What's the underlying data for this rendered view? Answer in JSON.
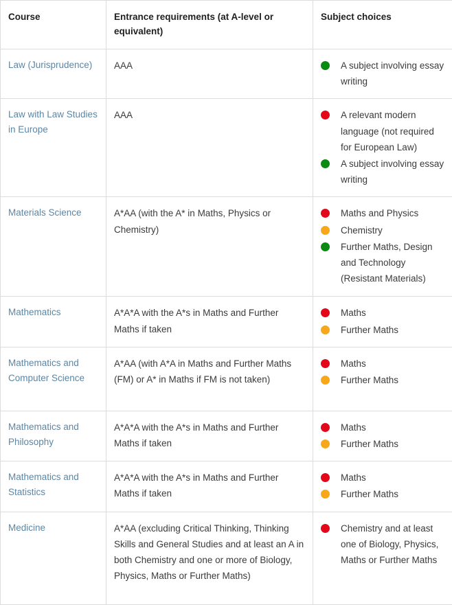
{
  "table": {
    "columns": [
      {
        "label": "Course"
      },
      {
        "label": "Entrance requirements (at A-level or equivalent)"
      },
      {
        "label": "Subject choices"
      }
    ],
    "colors": {
      "red": "#e2071b",
      "amber": "#f6a71c",
      "green": "#0a8a12",
      "link": "#5b86a4",
      "border": "#dcdcdc",
      "header_text": "#1f1f1f",
      "body_text": "#3a3a3a"
    },
    "rows": [
      {
        "course": "Law (Jurisprudence)",
        "requirements": "AAA",
        "subjects": [
          {
            "colour": "green",
            "text": "A subject involving essay writing"
          }
        ]
      },
      {
        "course": "Law with Law Studies in Europe",
        "requirements": "AAA",
        "subjects": [
          {
            "colour": "red",
            "text": "A relevant modern language (not required for European Law)"
          },
          {
            "colour": "green",
            "text": "A subject involving essay writing"
          }
        ]
      },
      {
        "course": "Materials Science",
        "requirements": "A*AA (with the A* in Maths, Physics or Chemistry)",
        "subjects": [
          {
            "colour": "red",
            "text": "Maths and Physics"
          },
          {
            "colour": "amber",
            "text": "Chemistry"
          },
          {
            "colour": "green",
            "text": "Further Maths, Design and Technology (Resistant Materials)"
          }
        ]
      },
      {
        "course": "Mathematics",
        "requirements": "A*A*A with the A*s in Maths and Further Maths if taken",
        "subjects": [
          {
            "colour": "red",
            "text": "Maths"
          },
          {
            "colour": "amber",
            "text": "Further Maths"
          }
        ]
      },
      {
        "course": "Mathematics and Computer Science",
        "requirements": "A*AA (with A*A in Maths and Further Maths (FM) or A* in Maths if FM is not taken)",
        "subjects": [
          {
            "colour": "red",
            "text": "Maths"
          },
          {
            "colour": "amber",
            "text": "Further Maths"
          }
        ]
      },
      {
        "course": "Mathematics and Philosophy",
        "requirements": "A*A*A with the A*s in Maths and Further Maths if taken",
        "subjects": [
          {
            "colour": "red",
            "text": "Maths"
          },
          {
            "colour": "amber",
            "text": "Further Maths"
          }
        ]
      },
      {
        "course": "Mathematics and Statistics",
        "requirements": "A*A*A with the A*s in Maths and Further Maths if taken",
        "subjects": [
          {
            "colour": "red",
            "text": "Maths"
          },
          {
            "colour": "amber",
            "text": "Further Maths"
          }
        ]
      },
      {
        "course": "Medicine",
        "requirements": "A*AA (excluding Critical Thinking, Thinking Skills and General Studies and at least an A in both Chemistry and one or more of Biology, Physics, Maths or Further Maths)",
        "subjects": [
          {
            "colour": "red",
            "text": "Chemistry and at least one of Biology, Physics, Maths or Further Maths"
          }
        ]
      }
    ]
  }
}
